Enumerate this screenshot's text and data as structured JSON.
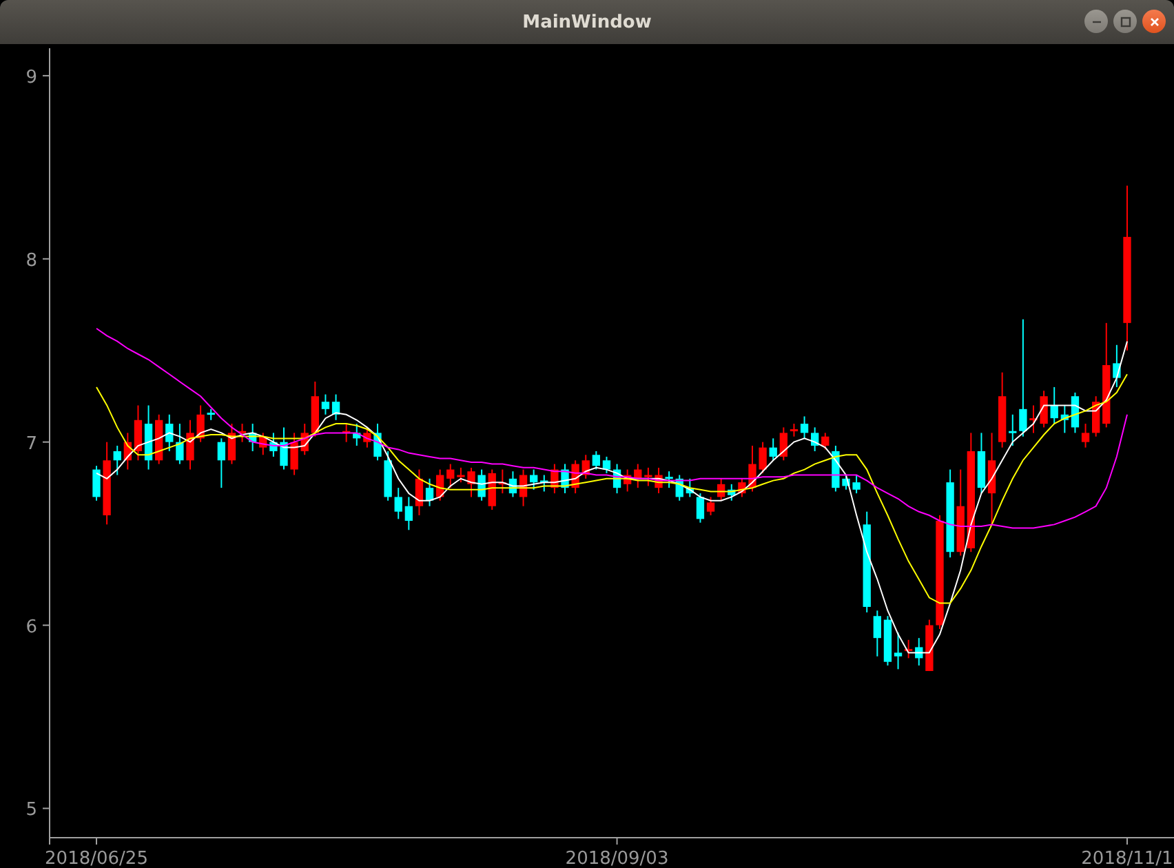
{
  "window": {
    "title": "MainWindow"
  },
  "chart": {
    "chart_data": {
      "type": "candlestick",
      "ylim": [
        4.84,
        9.15
      ],
      "yticks": [
        5,
        6,
        7,
        8,
        9
      ],
      "categories": [
        "2018/06/25",
        null,
        null,
        null,
        null,
        null,
        null,
        null,
        null,
        null,
        null,
        null,
        null,
        null,
        null,
        null,
        null,
        null,
        null,
        null,
        null,
        null,
        null,
        null,
        null,
        null,
        null,
        null,
        null,
        null,
        null,
        null,
        null,
        null,
        null,
        null,
        null,
        null,
        null,
        null,
        null,
        null,
        null,
        null,
        null,
        null,
        null,
        null,
        null,
        null,
        "2018/09/03",
        null,
        null,
        null,
        null,
        null,
        null,
        null,
        null,
        null,
        null,
        null,
        null,
        null,
        null,
        null,
        null,
        null,
        null,
        null,
        null,
        null,
        null,
        null,
        null,
        null,
        null,
        null,
        null,
        null,
        null,
        null,
        null,
        null,
        null,
        null,
        null,
        null,
        null,
        null,
        null,
        null,
        null,
        null,
        null,
        null,
        null,
        null,
        null,
        "2018/11/1"
      ],
      "ohlc": [
        [
          6.85,
          6.87,
          6.68,
          6.7
        ],
        [
          6.6,
          7.0,
          6.55,
          6.9
        ],
        [
          6.95,
          6.98,
          6.82,
          6.9
        ],
        [
          6.9,
          7.05,
          6.85,
          7.0
        ],
        [
          6.95,
          7.2,
          6.9,
          7.12
        ],
        [
          7.1,
          7.2,
          6.85,
          6.9
        ],
        [
          6.9,
          7.15,
          6.88,
          7.12
        ],
        [
          7.1,
          7.15,
          6.95,
          7.0
        ],
        [
          7.0,
          7.1,
          6.88,
          6.9
        ],
        [
          6.9,
          7.12,
          6.85,
          7.05
        ],
        [
          7.02,
          7.2,
          7.0,
          7.15
        ],
        [
          7.16,
          7.18,
          7.12,
          7.15
        ],
        [
          7.0,
          7.02,
          6.75,
          6.9
        ],
        [
          6.9,
          7.1,
          6.88,
          7.05
        ],
        [
          7.05,
          7.1,
          7.0,
          7.06
        ],
        [
          7.05,
          7.1,
          6.95,
          7.0
        ],
        [
          6.97,
          7.05,
          6.93,
          7.03
        ],
        [
          7.0,
          7.05,
          6.92,
          6.95
        ],
        [
          7.0,
          7.08,
          6.85,
          6.87
        ],
        [
          6.85,
          7.05,
          6.82,
          7.0
        ],
        [
          6.95,
          7.1,
          6.93,
          7.05
        ],
        [
          7.05,
          7.33,
          7.03,
          7.25
        ],
        [
          7.22,
          7.26,
          7.15,
          7.18
        ],
        [
          7.22,
          7.26,
          7.12,
          7.15
        ],
        [
          7.05,
          7.1,
          7.0,
          7.06
        ],
        [
          7.05,
          7.1,
          6.98,
          7.02
        ],
        [
          7.0,
          7.08,
          6.97,
          7.05
        ],
        [
          7.05,
          7.1,
          6.9,
          6.92
        ],
        [
          6.9,
          6.95,
          6.68,
          6.7
        ],
        [
          6.7,
          6.75,
          6.58,
          6.62
        ],
        [
          6.65,
          6.7,
          6.52,
          6.57
        ],
        [
          6.65,
          6.85,
          6.6,
          6.8
        ],
        [
          6.75,
          6.8,
          6.65,
          6.68
        ],
        [
          6.7,
          6.85,
          6.68,
          6.82
        ],
        [
          6.8,
          6.88,
          6.75,
          6.85
        ],
        [
          6.81,
          6.86,
          6.78,
          6.82
        ],
        [
          6.77,
          6.86,
          6.7,
          6.84
        ],
        [
          6.82,
          6.85,
          6.68,
          6.7
        ],
        [
          6.65,
          6.85,
          6.63,
          6.83
        ],
        [
          6.77,
          6.85,
          6.72,
          6.78
        ],
        [
          6.8,
          6.84,
          6.7,
          6.72
        ],
        [
          6.7,
          6.85,
          6.65,
          6.82
        ],
        [
          6.82,
          6.85,
          6.74,
          6.78
        ],
        [
          6.79,
          6.82,
          6.73,
          6.78
        ],
        [
          6.75,
          6.88,
          6.72,
          6.85
        ],
        [
          6.85,
          6.88,
          6.72,
          6.75
        ],
        [
          6.75,
          6.9,
          6.72,
          6.88
        ],
        [
          6.82,
          6.93,
          6.8,
          6.9
        ],
        [
          6.93,
          6.95,
          6.85,
          6.87
        ],
        [
          6.9,
          6.92,
          6.83,
          6.85
        ],
        [
          6.85,
          6.88,
          6.72,
          6.75
        ],
        [
          6.77,
          6.85,
          6.73,
          6.82
        ],
        [
          6.8,
          6.88,
          6.75,
          6.85
        ],
        [
          6.81,
          6.86,
          6.76,
          6.82
        ],
        [
          6.75,
          6.86,
          6.72,
          6.82
        ],
        [
          6.81,
          6.84,
          6.75,
          6.8
        ],
        [
          6.8,
          6.82,
          6.68,
          6.7
        ],
        [
          6.75,
          6.8,
          6.7,
          6.72
        ],
        [
          6.7,
          6.72,
          6.56,
          6.58
        ],
        [
          6.62,
          6.7,
          6.6,
          6.67
        ],
        [
          6.7,
          6.8,
          6.68,
          6.77
        ],
        [
          6.74,
          6.77,
          6.68,
          6.71
        ],
        [
          6.72,
          6.8,
          6.7,
          6.78
        ],
        [
          6.75,
          6.98,
          6.73,
          6.88
        ],
        [
          6.85,
          7.0,
          6.83,
          6.97
        ],
        [
          6.97,
          7.02,
          6.9,
          6.92
        ],
        [
          6.92,
          7.08,
          6.9,
          7.05
        ],
        [
          7.06,
          7.1,
          7.03,
          7.07
        ],
        [
          7.1,
          7.14,
          7.02,
          7.05
        ],
        [
          7.05,
          7.08,
          6.95,
          6.98
        ],
        [
          6.98,
          7.05,
          6.96,
          7.03
        ],
        [
          6.95,
          6.98,
          6.73,
          6.75
        ],
        [
          6.8,
          6.82,
          6.74,
          6.76
        ],
        [
          6.78,
          6.82,
          6.72,
          6.74
        ],
        [
          6.55,
          6.62,
          6.07,
          6.1
        ],
        [
          6.05,
          6.08,
          5.83,
          5.93
        ],
        [
          6.03,
          6.05,
          5.78,
          5.8
        ],
        [
          5.85,
          5.96,
          5.76,
          5.83
        ],
        [
          5.86,
          5.92,
          5.82,
          5.87
        ],
        [
          5.88,
          5.93,
          5.78,
          5.82
        ],
        [
          5.75,
          6.03,
          5.75,
          6.0
        ],
        [
          6.0,
          6.6,
          5.98,
          6.57
        ],
        [
          6.78,
          6.85,
          6.37,
          6.4
        ],
        [
          6.4,
          6.85,
          6.38,
          6.65
        ],
        [
          6.42,
          7.05,
          6.4,
          6.95
        ],
        [
          6.95,
          7.05,
          6.72,
          6.75
        ],
        [
          6.72,
          7.05,
          6.55,
          6.9
        ],
        [
          7.0,
          7.38,
          6.97,
          7.25
        ],
        [
          7.06,
          7.15,
          6.98,
          7.05
        ],
        [
          7.18,
          7.67,
          7.03,
          7.06
        ],
        [
          7.12,
          7.2,
          7.05,
          7.13
        ],
        [
          7.1,
          7.28,
          7.08,
          7.25
        ],
        [
          7.2,
          7.3,
          7.1,
          7.13
        ],
        [
          7.15,
          7.2,
          7.05,
          7.12
        ],
        [
          7.25,
          7.27,
          7.05,
          7.08
        ],
        [
          7.0,
          7.1,
          6.97,
          7.05
        ],
        [
          7.05,
          7.25,
          7.03,
          7.22
        ],
        [
          7.1,
          7.65,
          7.08,
          7.42
        ],
        [
          7.43,
          7.53,
          7.3,
          7.35
        ],
        [
          7.65,
          8.4,
          7.5,
          8.12
        ]
      ],
      "series": [
        {
          "type": "line",
          "color": "#ffffff",
          "values": [
            6.83,
            6.8,
            6.85,
            6.92,
            6.98,
            7.0,
            7.02,
            7.05,
            7.03,
            7.0,
            7.05,
            7.07,
            7.05,
            7.02,
            7.04,
            7.05,
            7.03,
            7.0,
            6.97,
            6.97,
            6.98,
            7.05,
            7.13,
            7.16,
            7.15,
            7.12,
            7.08,
            7.03,
            6.92,
            6.8,
            6.72,
            6.68,
            6.68,
            6.7,
            6.76,
            6.8,
            6.78,
            6.77,
            6.78,
            6.78,
            6.76,
            6.76,
            6.77,
            6.78,
            6.78,
            6.79,
            6.8,
            6.84,
            6.86,
            6.85,
            6.83,
            6.8,
            6.8,
            6.8,
            6.8,
            6.79,
            6.77,
            6.74,
            6.7,
            6.68,
            6.68,
            6.7,
            6.73,
            6.78,
            6.84,
            6.9,
            6.95,
            7.0,
            7.02,
            7.0,
            6.97,
            6.9,
            6.82,
            6.6,
            6.4,
            6.25,
            6.08,
            5.95,
            5.85,
            5.85,
            5.85,
            5.95,
            6.12,
            6.3,
            6.55,
            6.72,
            6.8,
            6.9,
            7.0,
            7.05,
            7.1,
            7.2,
            7.2,
            7.2,
            7.2,
            7.17,
            7.17,
            7.23,
            7.35,
            7.55
          ]
        },
        {
          "type": "line",
          "color": "#ffff00",
          "values": [
            7.3,
            7.2,
            7.08,
            6.98,
            6.93,
            6.93,
            6.95,
            6.97,
            6.99,
            7.02,
            7.03,
            7.04,
            7.04,
            7.03,
            7.03,
            7.03,
            7.03,
            7.02,
            7.02,
            7.02,
            7.02,
            7.05,
            7.08,
            7.1,
            7.1,
            7.09,
            7.07,
            7.03,
            6.97,
            6.9,
            6.85,
            6.8,
            6.77,
            6.75,
            6.74,
            6.74,
            6.74,
            6.74,
            6.75,
            6.75,
            6.75,
            6.75,
            6.75,
            6.76,
            6.76,
            6.76,
            6.77,
            6.78,
            6.79,
            6.8,
            6.8,
            6.8,
            6.79,
            6.79,
            6.78,
            6.78,
            6.77,
            6.75,
            6.74,
            6.73,
            6.73,
            6.73,
            6.74,
            6.75,
            6.77,
            6.79,
            6.8,
            6.83,
            6.85,
            6.88,
            6.9,
            6.92,
            6.93,
            6.93,
            6.85,
            6.72,
            6.6,
            6.47,
            6.35,
            6.25,
            6.15,
            6.12,
            6.12,
            6.2,
            6.3,
            6.43,
            6.55,
            6.68,
            6.8,
            6.9,
            6.97,
            7.04,
            7.1,
            7.13,
            7.15,
            7.17,
            7.2,
            7.22,
            7.27,
            7.37
          ]
        },
        {
          "type": "line",
          "color": "#ff00ff",
          "values": [
            7.62,
            7.58,
            7.55,
            7.51,
            7.48,
            7.45,
            7.41,
            7.37,
            7.33,
            7.29,
            7.25,
            7.19,
            7.13,
            7.08,
            7.04,
            7.0,
            6.99,
            6.98,
            6.98,
            7.0,
            7.02,
            7.04,
            7.05,
            7.05,
            7.05,
            7.05,
            7.02,
            7.0,
            6.97,
            6.96,
            6.94,
            6.93,
            6.92,
            6.91,
            6.91,
            6.9,
            6.89,
            6.89,
            6.88,
            6.88,
            6.87,
            6.86,
            6.86,
            6.85,
            6.84,
            6.84,
            6.83,
            6.83,
            6.82,
            6.82,
            6.81,
            6.81,
            6.8,
            6.8,
            6.79,
            6.79,
            6.79,
            6.79,
            6.8,
            6.8,
            6.8,
            6.8,
            6.8,
            6.8,
            6.81,
            6.81,
            6.81,
            6.82,
            6.82,
            6.82,
            6.82,
            6.82,
            6.82,
            6.82,
            6.79,
            6.75,
            6.72,
            6.69,
            6.65,
            6.62,
            6.6,
            6.57,
            6.55,
            6.54,
            6.54,
            6.54,
            6.55,
            6.54,
            6.53,
            6.53,
            6.53,
            6.54,
            6.55,
            6.57,
            6.59,
            6.62,
            6.65,
            6.75,
            6.92,
            7.15
          ]
        }
      ]
    }
  }
}
